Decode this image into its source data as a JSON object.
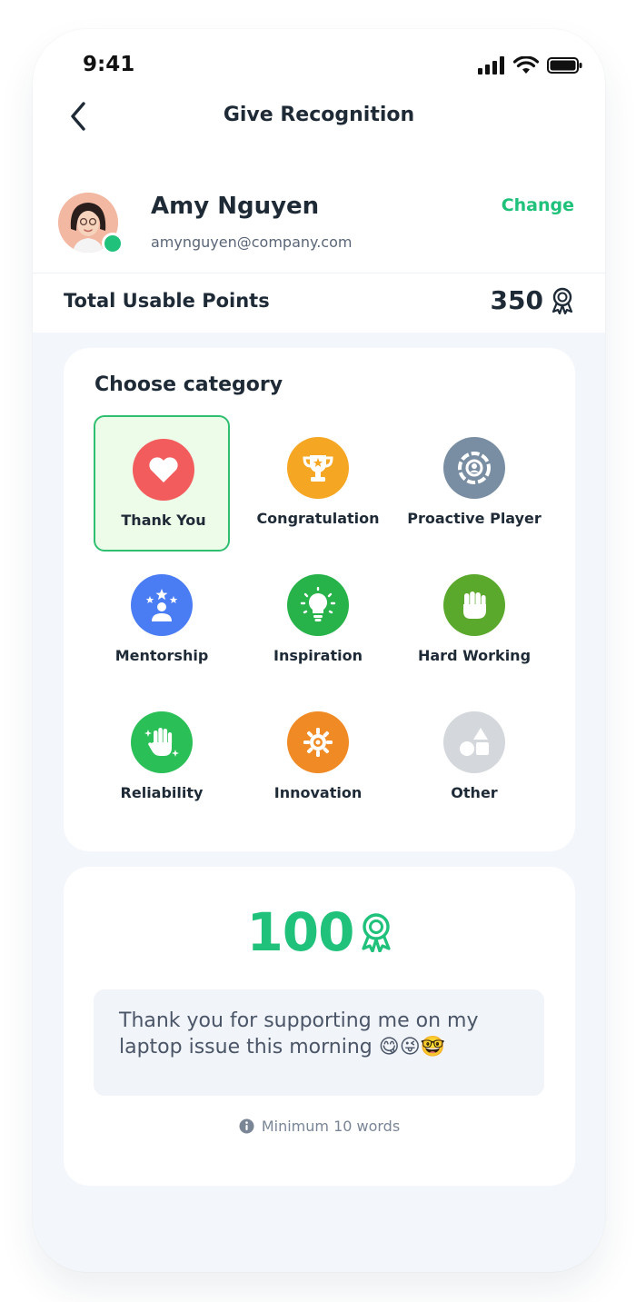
{
  "status_bar": {
    "time": "9:41"
  },
  "header": {
    "title": "Give Recognition"
  },
  "recipient": {
    "name": "Amy Nguyen",
    "email": "amynguyen@company.com",
    "change_label": "Change"
  },
  "points": {
    "label": "Total Usable Points",
    "value": "350"
  },
  "category_section": {
    "title": "Choose category",
    "selected": "Thank You",
    "items": [
      {
        "label": "Thank You",
        "icon": "heart-icon",
        "color": "#f25c5c"
      },
      {
        "label": "Congratulation",
        "icon": "trophy-icon",
        "color": "#f5a623"
      },
      {
        "label": "Proactive Player",
        "icon": "target-icon",
        "color": "#7a8ea3"
      },
      {
        "label": "Mentorship",
        "icon": "mentor-star-icon",
        "color": "#4a7cf3"
      },
      {
        "label": "Inspiration",
        "icon": "lightbulb-icon",
        "color": "#27b24a"
      },
      {
        "label": "Hard Working",
        "icon": "fist-icon",
        "color": "#5aa82c"
      },
      {
        "label": "Reliability",
        "icon": "hand-sparkle-icon",
        "color": "#2bbf58"
      },
      {
        "label": "Innovation",
        "icon": "gear-sun-icon",
        "color": "#f08a24"
      },
      {
        "label": "Other",
        "icon": "shapes-icon",
        "color": "#d4d7db"
      }
    ]
  },
  "recognition": {
    "amount": "100",
    "message": "Thank you for supporting me on my laptop issue this morning 😋😜🤓",
    "hint": "Minimum 10 words"
  },
  "colors": {
    "accent": "#1fc17b",
    "background": "#f3f6fa"
  }
}
